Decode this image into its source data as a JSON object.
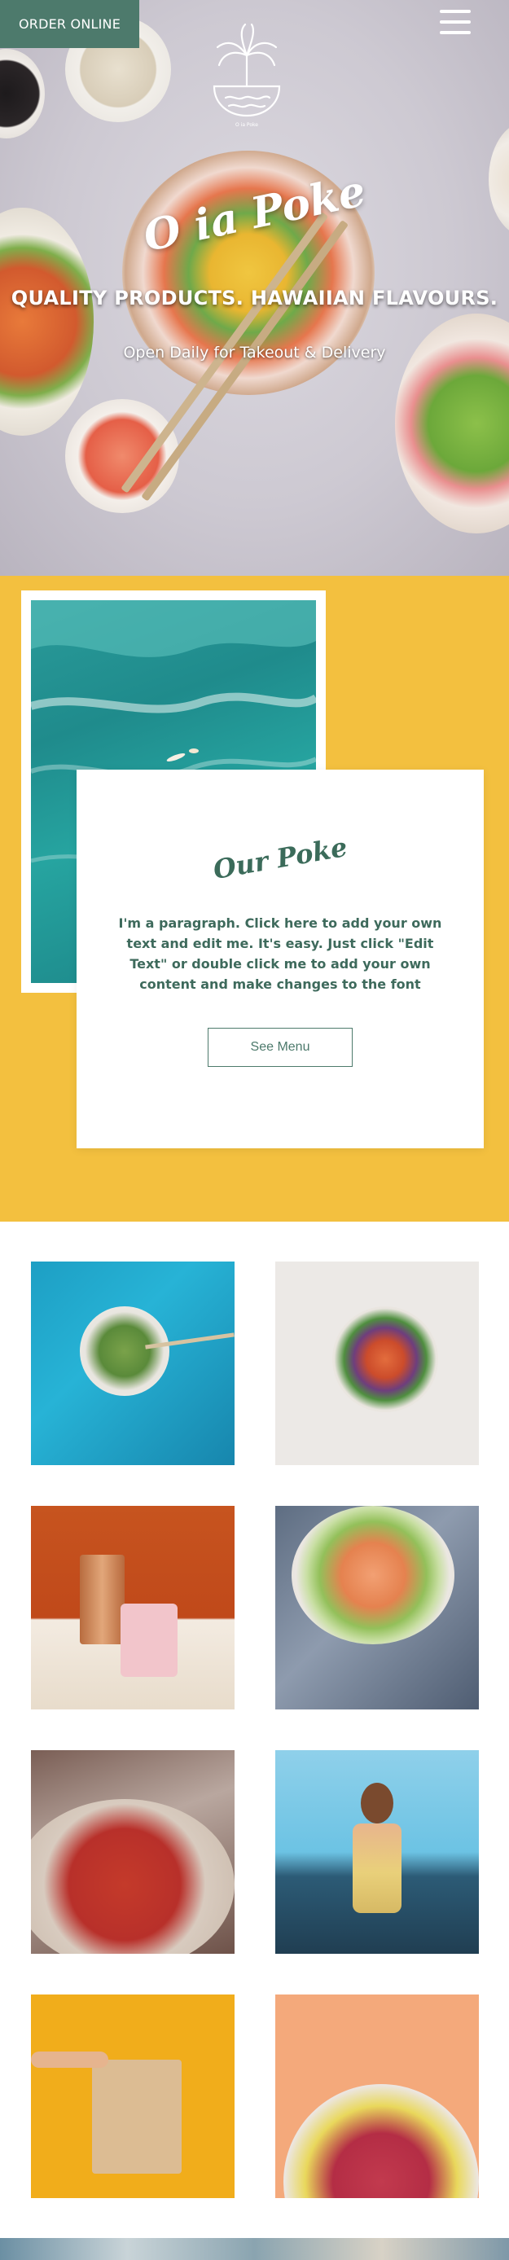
{
  "header": {
    "order_label": "ORDER ONLINE",
    "logo_caption": "O ia Poke",
    "menu_icon": "hamburger-menu-icon"
  },
  "hero": {
    "title": "O ia Poke",
    "subtitle": "QUALITY PRODUCTS. HAWAIIAN FLAVOURS.",
    "tagline": "Open Daily for Takeout & Delivery"
  },
  "about": {
    "title": "Our Poke",
    "paragraph": "I'm a paragraph. Click here to add your own text and edit me. It's easy. Just click \"Edit Text\" or double click me to add your own content and make changes to the font",
    "button_label": "See Menu"
  },
  "colors": {
    "accent_green": "#4d7a6c",
    "yellow": "#f3c03f",
    "white": "#ffffff"
  }
}
